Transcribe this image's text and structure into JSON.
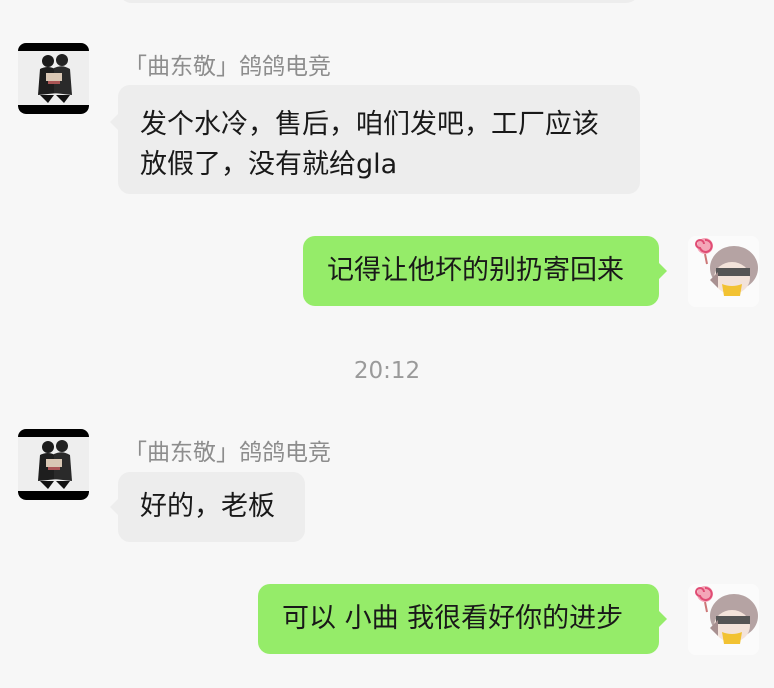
{
  "messages": [
    {
      "sender": "「曲东敬」鸽鸽电竞",
      "direction": "in",
      "lines": [
        "发个水冷，售后，咱们发吧，工厂应该",
        "放假了，没有就给gla"
      ]
    },
    {
      "direction": "out",
      "lines": [
        "记得让他坏的别扔寄回来"
      ]
    },
    {
      "sender": "「曲东敬」鸽鸽电竞",
      "direction": "in",
      "lines": [
        "好的，老板"
      ]
    },
    {
      "direction": "out",
      "lines": [
        "可以 小曲 我很看好你的进步"
      ]
    }
  ],
  "timestamp": "20:12",
  "colors": {
    "background": "#f7f7f7",
    "incoming_bubble": "#ededed",
    "outgoing_bubble": "#95ec69",
    "sender_name": "#8d8d8d",
    "timestamp": "#9a9a9a"
  },
  "icons": {
    "contact_avatar": "anime-figures-avatar",
    "self_avatar": "anime-girl-lollipop-avatar"
  }
}
